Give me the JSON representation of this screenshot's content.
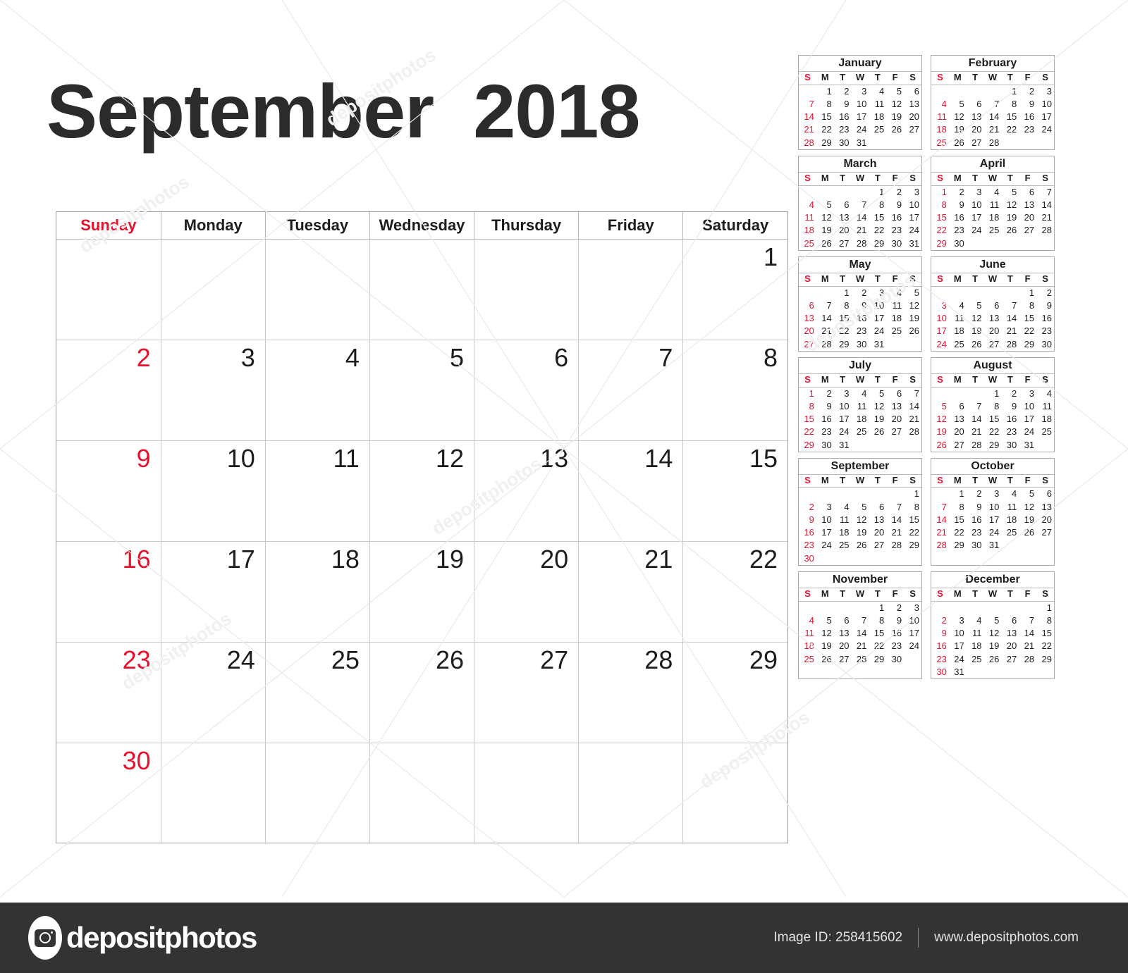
{
  "title": {
    "month": "September",
    "year": "2018",
    "full": "September 2018"
  },
  "main_calendar": {
    "weekday_headers": [
      "Sunday",
      "Monday",
      "Tuesday",
      "Wednesday",
      "Thursday",
      "Friday",
      "Saturday"
    ],
    "sunday_color": "#e8112d",
    "weeks": [
      [
        "",
        "",
        "",
        "",
        "",
        "",
        "1"
      ],
      [
        "2",
        "3",
        "4",
        "5",
        "6",
        "7",
        "8"
      ],
      [
        "9",
        "10",
        "11",
        "12",
        "13",
        "14",
        "15"
      ],
      [
        "16",
        "17",
        "18",
        "19",
        "20",
        "21",
        "22"
      ],
      [
        "23",
        "24",
        "25",
        "26",
        "27",
        "28",
        "29"
      ],
      [
        "30",
        "",
        "",
        "",
        "",
        "",
        ""
      ]
    ]
  },
  "mini_calendars": {
    "weekday_headers": [
      "S",
      "M",
      "T",
      "W",
      "T",
      "F",
      "S"
    ],
    "months": [
      {
        "name": "January",
        "weeks": [
          [
            "",
            "1",
            "2",
            "3",
            "4",
            "5",
            "6"
          ],
          [
            "7",
            "8",
            "9",
            "10",
            "11",
            "12",
            "13"
          ],
          [
            "14",
            "15",
            "16",
            "17",
            "18",
            "19",
            "20"
          ],
          [
            "21",
            "22",
            "23",
            "24",
            "25",
            "26",
            "27"
          ],
          [
            "28",
            "29",
            "30",
            "31",
            "",
            "",
            ""
          ]
        ]
      },
      {
        "name": "February",
        "weeks": [
          [
            "",
            "",
            "",
            "",
            "1",
            "2",
            "3"
          ],
          [
            "4",
            "5",
            "6",
            "7",
            "8",
            "9",
            "10"
          ],
          [
            "11",
            "12",
            "13",
            "14",
            "15",
            "16",
            "17"
          ],
          [
            "18",
            "19",
            "20",
            "21",
            "22",
            "23",
            "24"
          ],
          [
            "25",
            "26",
            "27",
            "28",
            "",
            "",
            ""
          ]
        ]
      },
      {
        "name": "March",
        "weeks": [
          [
            "",
            "",
            "",
            "",
            "1",
            "2",
            "3"
          ],
          [
            "4",
            "5",
            "6",
            "7",
            "8",
            "9",
            "10"
          ],
          [
            "11",
            "12",
            "13",
            "14",
            "15",
            "16",
            "17"
          ],
          [
            "18",
            "19",
            "20",
            "21",
            "22",
            "23",
            "24"
          ],
          [
            "25",
            "26",
            "27",
            "28",
            "29",
            "30",
            "31"
          ]
        ]
      },
      {
        "name": "April",
        "weeks": [
          [
            "1",
            "2",
            "3",
            "4",
            "5",
            "6",
            "7"
          ],
          [
            "8",
            "9",
            "10",
            "11",
            "12",
            "13",
            "14"
          ],
          [
            "15",
            "16",
            "17",
            "18",
            "19",
            "20",
            "21"
          ],
          [
            "22",
            "23",
            "24",
            "25",
            "26",
            "27",
            "28"
          ],
          [
            "29",
            "30",
            "",
            "",
            "",
            "",
            ""
          ]
        ]
      },
      {
        "name": "May",
        "weeks": [
          [
            "",
            "",
            "1",
            "2",
            "3",
            "4",
            "5"
          ],
          [
            "6",
            "7",
            "8",
            "9",
            "10",
            "11",
            "12"
          ],
          [
            "13",
            "14",
            "15",
            "16",
            "17",
            "18",
            "19"
          ],
          [
            "20",
            "21",
            "22",
            "23",
            "24",
            "25",
            "26"
          ],
          [
            "27",
            "28",
            "29",
            "30",
            "31",
            "",
            ""
          ]
        ]
      },
      {
        "name": "June",
        "weeks": [
          [
            "",
            "",
            "",
            "",
            "",
            "1",
            "2"
          ],
          [
            "3",
            "4",
            "5",
            "6",
            "7",
            "8",
            "9"
          ],
          [
            "10",
            "11",
            "12",
            "13",
            "14",
            "15",
            "16"
          ],
          [
            "17",
            "18",
            "19",
            "20",
            "21",
            "22",
            "23"
          ],
          [
            "24",
            "25",
            "26",
            "27",
            "28",
            "29",
            "30"
          ]
        ]
      },
      {
        "name": "July",
        "weeks": [
          [
            "1",
            "2",
            "3",
            "4",
            "5",
            "6",
            "7"
          ],
          [
            "8",
            "9",
            "10",
            "11",
            "12",
            "13",
            "14"
          ],
          [
            "15",
            "16",
            "17",
            "18",
            "19",
            "20",
            "21"
          ],
          [
            "22",
            "23",
            "24",
            "25",
            "26",
            "27",
            "28"
          ],
          [
            "29",
            "30",
            "31",
            "",
            "",
            "",
            ""
          ]
        ]
      },
      {
        "name": "August",
        "weeks": [
          [
            "",
            "",
            "",
            "1",
            "2",
            "3",
            "4"
          ],
          [
            "5",
            "6",
            "7",
            "8",
            "9",
            "10",
            "11"
          ],
          [
            "12",
            "13",
            "14",
            "15",
            "16",
            "17",
            "18"
          ],
          [
            "19",
            "20",
            "21",
            "22",
            "23",
            "24",
            "25"
          ],
          [
            "26",
            "27",
            "28",
            "29",
            "30",
            "31",
            ""
          ]
        ]
      },
      {
        "name": "September",
        "weeks": [
          [
            "",
            "",
            "",
            "",
            "",
            "",
            "1"
          ],
          [
            "2",
            "3",
            "4",
            "5",
            "6",
            "7",
            "8"
          ],
          [
            "9",
            "10",
            "11",
            "12",
            "13",
            "14",
            "15"
          ],
          [
            "16",
            "17",
            "18",
            "19",
            "20",
            "21",
            "22"
          ],
          [
            "23",
            "24",
            "25",
            "26",
            "27",
            "28",
            "29"
          ],
          [
            "30",
            "",
            "",
            "",
            "",
            "",
            ""
          ]
        ]
      },
      {
        "name": "October",
        "weeks": [
          [
            "",
            "1",
            "2",
            "3",
            "4",
            "5",
            "6"
          ],
          [
            "7",
            "8",
            "9",
            "10",
            "11",
            "12",
            "13"
          ],
          [
            "14",
            "15",
            "16",
            "17",
            "18",
            "19",
            "20"
          ],
          [
            "21",
            "22",
            "23",
            "24",
            "25",
            "26",
            "27"
          ],
          [
            "28",
            "29",
            "30",
            "31",
            "",
            "",
            ""
          ]
        ]
      },
      {
        "name": "November",
        "weeks": [
          [
            "",
            "",
            "",
            "",
            "1",
            "2",
            "3"
          ],
          [
            "4",
            "5",
            "6",
            "7",
            "8",
            "9",
            "10"
          ],
          [
            "11",
            "12",
            "13",
            "14",
            "15",
            "16",
            "17"
          ],
          [
            "18",
            "19",
            "20",
            "21",
            "22",
            "23",
            "24"
          ],
          [
            "25",
            "26",
            "27",
            "28",
            "29",
            "30",
            ""
          ]
        ]
      },
      {
        "name": "December",
        "weeks": [
          [
            "",
            "",
            "",
            "",
            "",
            "",
            "1"
          ],
          [
            "2",
            "3",
            "4",
            "5",
            "6",
            "7",
            "8"
          ],
          [
            "9",
            "10",
            "11",
            "12",
            "13",
            "14",
            "15"
          ],
          [
            "16",
            "17",
            "18",
            "19",
            "20",
            "21",
            "22"
          ],
          [
            "23",
            "24",
            "25",
            "26",
            "27",
            "28",
            "29"
          ],
          [
            "30",
            "31",
            "",
            "",
            "",
            "",
            ""
          ]
        ]
      }
    ]
  },
  "footer": {
    "brand": "depositphotos",
    "logo_icon": "camera-icon",
    "image_id": "Image ID: 258415602",
    "website": "www.depositphotos.com"
  },
  "watermark": {
    "text": "depositphotos"
  }
}
